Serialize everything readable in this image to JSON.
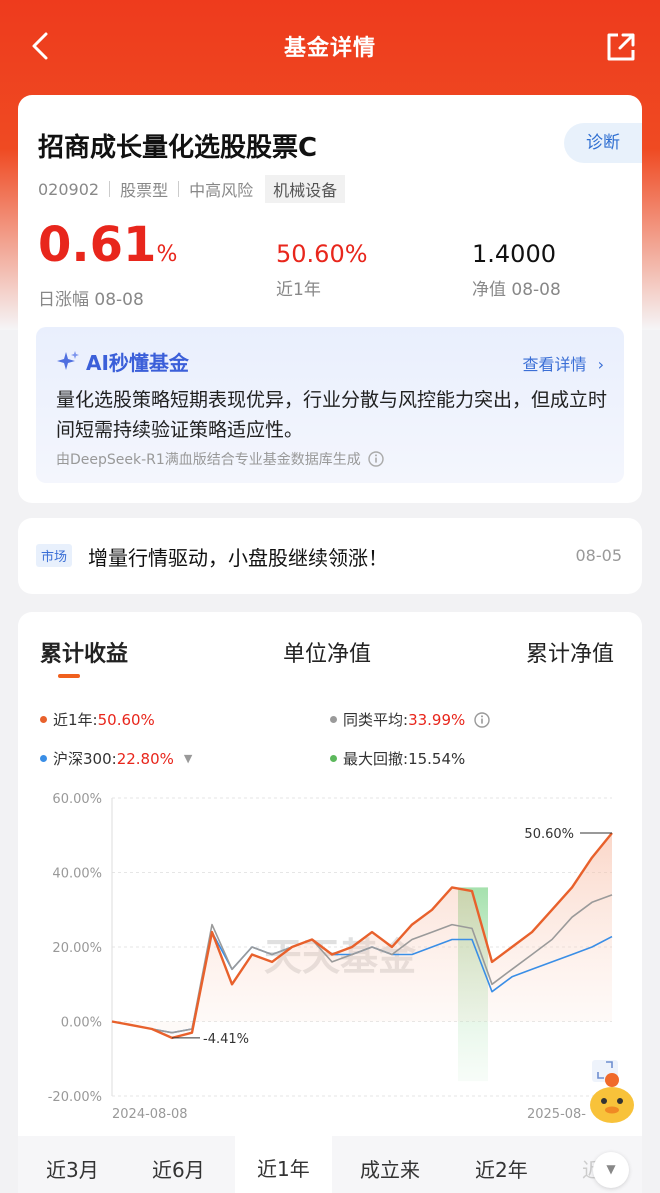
{
  "header": {
    "title": "基金详情"
  },
  "fund": {
    "name": "招商成长量化选股股票C",
    "code": "020902",
    "type": "股票型",
    "risk": "中高风险",
    "industry": "机械设备",
    "diagnose_label": "诊断",
    "daily_change": "0.61",
    "daily_change_unit": "%",
    "daily_change_label": "日涨幅 08-08",
    "year_return": "50.60%",
    "year_return_label": "近1年",
    "nav": "1.4000",
    "nav_label": "净值 08-08"
  },
  "ai": {
    "title": "AI秒懂基金",
    "more_label": "查看详情",
    "text": "量化选股策略短期表现优异，行业分散与风控能力突出，但成立时间短需持续验证策略适应性。",
    "footnote": "由DeepSeek-R1满血版结合专业基金数据库生成"
  },
  "news": {
    "tag": "市场",
    "text": "增量行情驱动，小盘股继续领涨！",
    "date": "08-05"
  },
  "chart_tabs": [
    "累计收益",
    "单位净值",
    "累计净值"
  ],
  "legend": {
    "fund_label": "近1年:",
    "fund_value": "50.60%",
    "peer_label": "同类平均:",
    "peer_value": "33.99%",
    "index_label": "沪深300:",
    "index_value": "22.80%",
    "drawdown_label": "最大回撤:",
    "drawdown_value": "15.54%"
  },
  "colors": {
    "fund": "#e8612c",
    "peer": "#9a9a9a",
    "index": "#3a8ee6",
    "drawdown": "#5cb85c",
    "accent_red": "#e8261c"
  },
  "chart_data": {
    "type": "line",
    "y_tick_labels": [
      "60.00%",
      "40.00%",
      "20.00%",
      "0.00%",
      "-20.00%"
    ],
    "ylim": [
      -20,
      60
    ],
    "x_tick_labels": [
      "2024-08-08",
      "2025-08-"
    ],
    "annotations": [
      "50.60%",
      "-4.41%"
    ],
    "watermark": "天天基金",
    "series": [
      {
        "name": "近1年",
        "values": [
          0,
          -1,
          -2,
          -4.41,
          -3,
          24,
          10,
          18,
          16,
          20,
          22,
          18,
          20,
          24,
          20,
          26,
          30,
          36,
          35,
          16,
          20,
          24,
          30,
          36,
          44,
          50.6
        ]
      },
      {
        "name": "同类平均",
        "values": [
          0,
          -1,
          -2,
          -3,
          -2,
          26,
          14,
          20,
          18,
          20,
          22,
          16,
          18,
          20,
          18,
          22,
          24,
          26,
          25,
          10,
          14,
          18,
          22,
          28,
          32,
          33.99
        ]
      },
      {
        "name": "沪深300",
        "values": [
          0,
          -1,
          -2,
          -3,
          -2,
          24,
          14,
          20,
          18,
          20,
          22,
          18,
          18,
          20,
          18,
          18,
          20,
          22,
          22,
          8,
          12,
          14,
          16,
          18,
          20,
          22.8
        ]
      }
    ]
  },
  "periods": [
    "近3月",
    "近6月",
    "近1年",
    "成立来",
    "近2年",
    "近"
  ],
  "active_period": "近1年"
}
